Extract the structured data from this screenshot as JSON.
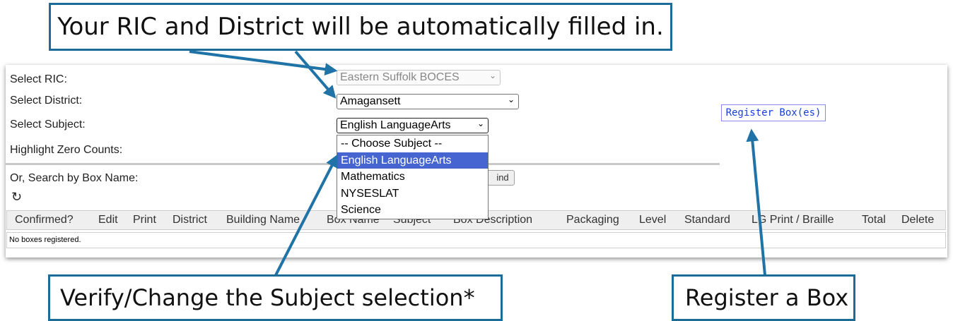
{
  "callouts": {
    "top": "Your RIC and District will be automatically filled in.",
    "bottom_left": "Verify/Change the Subject selection*",
    "bottom_right": "Register a Box"
  },
  "form": {
    "ric_label": "Select RIC:",
    "ric_value": "Eastern Suffolk BOCES",
    "district_label": "Select District:",
    "district_value": "Amagansett",
    "subject_label": "Select Subject:",
    "subject_value": "English LanguageArts",
    "highlight_label": "Highlight Zero Counts:",
    "search_label": "Or, Search by Box Name:",
    "find_button": "ind",
    "register_button": "Register Box(es)"
  },
  "subject_options": [
    "-- Choose Subject --",
    "English LanguageArts",
    "Mathematics",
    "NYSESLAT",
    "Science"
  ],
  "subject_selected_index": 1,
  "table": {
    "columns": [
      "Confirmed?",
      "Edit",
      "Print",
      "District",
      "Building Name",
      "Box Name",
      "Subject",
      "Box Description",
      "Packaging",
      "Level",
      "Standard",
      "LG Print / Braille",
      "Total",
      "Delete"
    ],
    "empty_message": "No boxes registered."
  },
  "icons": {
    "refresh": "refresh-icon",
    "chevron": "chevron-down-icon"
  },
  "colors": {
    "callout_border": "#1d6c97",
    "arrow": "#1f73a6",
    "selected_option": "#4665d0",
    "register_link": "#1a3fd8"
  }
}
